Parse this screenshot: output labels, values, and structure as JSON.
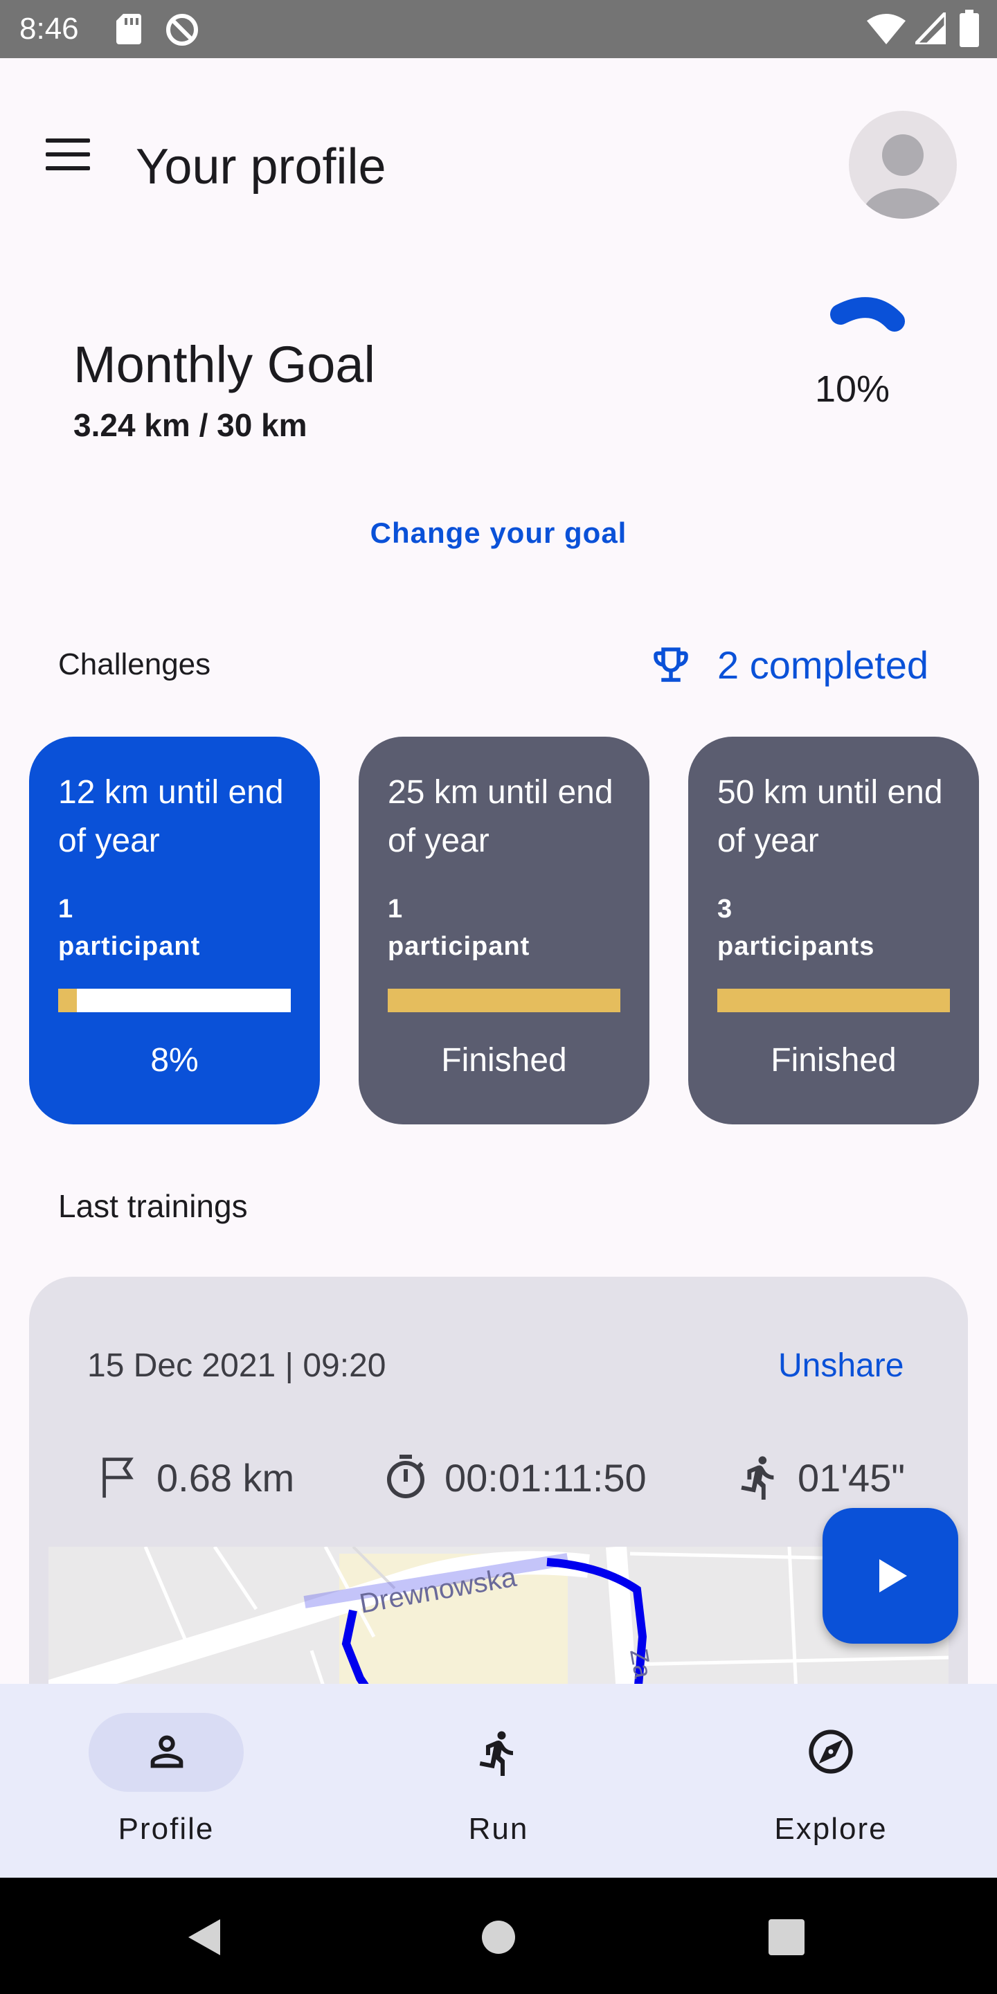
{
  "status_bar": {
    "time": "8:46",
    "icons": [
      "sd-card-icon",
      "do-not-disturb-icon",
      "wifi-icon",
      "signal-icon",
      "battery-icon"
    ]
  },
  "app_bar": {
    "title": "Your profile",
    "menu_icon": "menu-icon",
    "avatar_icon": "account-avatar-icon"
  },
  "monthly_goal": {
    "title": "Monthly Goal",
    "progress_text": "3.24 km / 30 km",
    "percent_label": "10%",
    "progress_fraction": 0.1,
    "change_label": "Change your goal"
  },
  "challenges": {
    "title": "Challenges",
    "completed_label": "2 completed",
    "items": [
      {
        "title": "12 km until end of year",
        "count": "1",
        "participants_label": "participant",
        "status": "8%",
        "progress": 0.08,
        "bg": "#0a51d8",
        "bar_bg": "#ffffff",
        "bar_fill": "#e5bd5d"
      },
      {
        "title": "25 km until end of year",
        "count": "1",
        "participants_label": "participant",
        "status": "Finished",
        "progress": 1.0,
        "bg": "#5b5d70",
        "bar_bg": "#e5bd5d",
        "bar_fill": "#e5bd5d"
      },
      {
        "title": "50 km until end of year",
        "count": "3",
        "participants_label": "participants",
        "status": "Finished",
        "progress": 1.0,
        "bg": "#5b5d70",
        "bar_bg": "#e5bd5d",
        "bar_fill": "#e5bd5d"
      }
    ]
  },
  "trainings": {
    "title": "Last trainings",
    "items": [
      {
        "date": "15 Dec 2021 | 09:20",
        "action_label": "Unshare",
        "distance": "0.68 km",
        "duration": "00:01:11:50",
        "pace": "01'45\"",
        "map_labels": {
          "street_1": "Drewnowska",
          "street_2": "Za"
        }
      }
    ]
  },
  "fab": {
    "icon": "play-icon"
  },
  "bottom_nav": {
    "items": [
      {
        "label": "Profile",
        "icon": "person-icon",
        "active": true
      },
      {
        "label": "Run",
        "icon": "run-icon",
        "active": false
      },
      {
        "label": "Explore",
        "icon": "compass-icon",
        "active": false
      }
    ]
  },
  "colors": {
    "accent": "#0a51d8",
    "card_dark": "#5b5d70",
    "progress_gold": "#e5bd5d",
    "route": "#0000ee"
  }
}
